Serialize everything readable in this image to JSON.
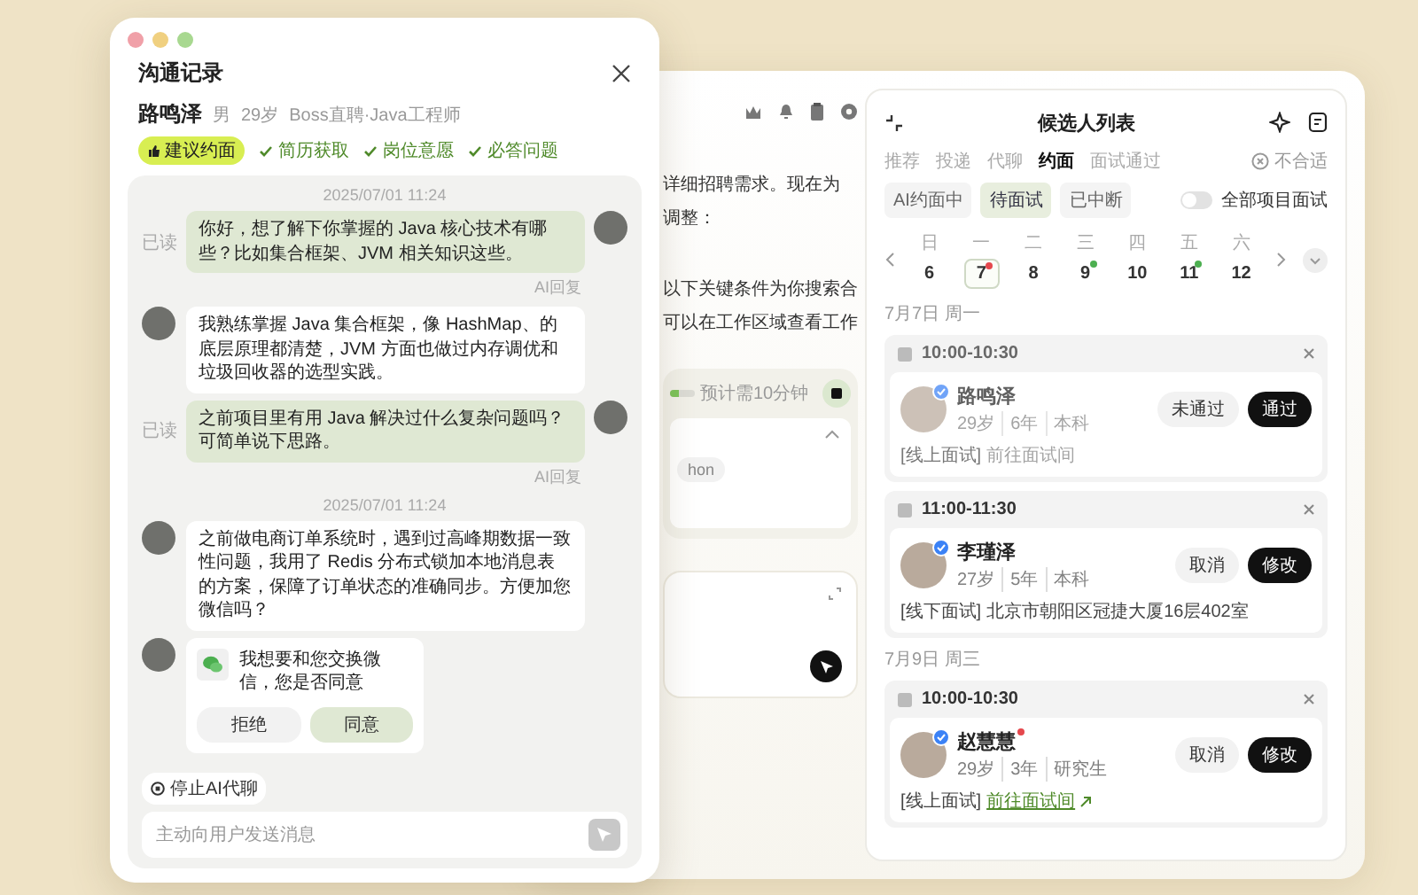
{
  "chat_window": {
    "title": "沟通记录",
    "candidate": {
      "name": "路鸣泽",
      "gender": "男",
      "age": "29岁",
      "source": "Boss直聘·Java工程师"
    },
    "badge": "建议约面",
    "checks": [
      "简历获取",
      "岗位意愿",
      "必答问题"
    ],
    "messages": [
      {
        "kind": "time",
        "text": "2025/07/01 11:24"
      },
      {
        "kind": "out",
        "text": "你好，想了解下你掌握的 Java 核心技术有哪些？比如集合框架、JVM 相关知识这些。",
        "status": "已读",
        "note": "AI回复"
      },
      {
        "kind": "in",
        "text": "我熟练掌握 Java 集合框架，像 HashMap、的底层原理都清楚，JVM 方面也做过内存调优和垃圾回收器的选型实践。"
      },
      {
        "kind": "out",
        "text": "之前项目里有用 Java 解决过什么复杂问题吗？可简单说下思路。",
        "status": "已读",
        "note": "AI回复"
      },
      {
        "kind": "time",
        "text": "2025/07/01 11:24"
      },
      {
        "kind": "in",
        "text": "之前做电商订单系统时，遇到过高峰期数据一致性问题，我用了 Redis 分布式锁加本地消息表的方案，保障了订单状态的准确同步。方便加您微信吗？"
      },
      {
        "kind": "wechat",
        "text": "我想要和您交换微信，您是否同意",
        "buttons": [
          {
            "label": "拒绝",
            "kind": "secondary"
          },
          {
            "label": "同意",
            "kind": "primary"
          }
        ]
      }
    ],
    "stop_button": "停止AI代聊",
    "input": {
      "placeholder": "主动向用户发送消息"
    }
  },
  "workspace": {
    "fragments": [
      "详细招聘需求。现在为",
      "调整：",
      "以下关键条件为你搜索合",
      "可以在工作区域查看工作"
    ],
    "task_card": {
      "progress": {
        "level": 0.35
      },
      "eta": "预计需10分钟",
      "tag": "hon"
    }
  },
  "candidates": {
    "title": "候选人列表",
    "tabs": [
      {
        "label": "推荐",
        "selected": false
      },
      {
        "label": "投递",
        "selected": false
      },
      {
        "label": "代聊",
        "selected": false
      },
      {
        "label": "约面",
        "selected": true
      },
      {
        "label": "面试通过",
        "selected": false
      }
    ],
    "reject_filter": "不合适",
    "chips": [
      {
        "label": "AI约面中",
        "selected": false
      },
      {
        "label": "待面试",
        "selected": true
      },
      {
        "label": "已中断",
        "selected": false
      }
    ],
    "all_projects": {
      "label": "全部项目面试",
      "on": false
    },
    "days": [
      {
        "weekday": "日",
        "day": "6",
        "selected": false
      },
      {
        "weekday": "一",
        "day": "7",
        "selected": true,
        "color": "#e5484d"
      },
      {
        "weekday": "二",
        "day": "8",
        "selected": false
      },
      {
        "weekday": "三",
        "day": "9",
        "selected": false,
        "color": "#4caf50"
      },
      {
        "weekday": "四",
        "day": "10",
        "selected": false
      },
      {
        "weekday": "五",
        "day": "11",
        "selected": false,
        "color": "#4caf50"
      },
      {
        "weekday": "六",
        "day": "12",
        "selected": false
      }
    ],
    "groups": [
      {
        "date": "7月7日 周一",
        "slots": [
          {
            "time": "10:00-10:30",
            "name": "路鸣泽",
            "dimmed": true,
            "unread": false,
            "meta": [
              "29岁",
              "6年",
              "本科"
            ],
            "mode": "[线上面试]",
            "detail": "前往面试间",
            "kind": "link",
            "buttons": [
              {
                "label": "未通过",
                "kind": "secondary"
              },
              {
                "label": "通过",
                "kind": "primary"
              }
            ]
          },
          {
            "time": "11:00-11:30",
            "name": "李瑾泽",
            "dimmed": false,
            "unread": false,
            "meta": [
              "27岁",
              "5年",
              "本科"
            ],
            "mode": "[线下面试]",
            "detail": "北京市朝阳区冠捷大厦16层402室",
            "kind": "text",
            "buttons": [
              {
                "label": "取消",
                "kind": "secondary"
              },
              {
                "label": "修改",
                "kind": "primary"
              }
            ]
          }
        ]
      },
      {
        "date": "7月9日 周三",
        "slots": [
          {
            "time": "10:00-10:30",
            "name": "赵慧慧",
            "dimmed": false,
            "unread": true,
            "meta": [
              "29岁",
              "3年",
              "研究生"
            ],
            "mode": "[线上面试]",
            "detail": "前往面试间",
            "kind": "link",
            "buttons": [
              {
                "label": "取消",
                "kind": "secondary"
              },
              {
                "label": "修改",
                "kind": "primary"
              }
            ]
          }
        ]
      }
    ]
  }
}
